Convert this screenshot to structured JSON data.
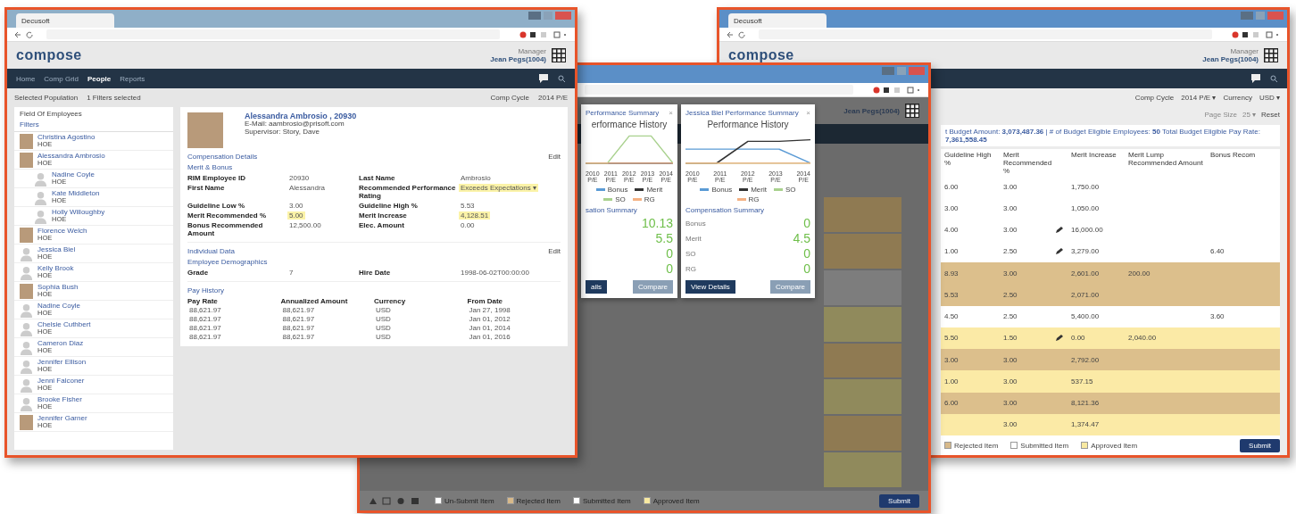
{
  "people_window": {
    "tab": "Decusoft",
    "logo": "compose",
    "user_role": "Manager",
    "user": "Jean Pegs(1004)",
    "nav": [
      {
        "label": "Home",
        "selected": false
      },
      {
        "label": "Comp Grid",
        "selected": false
      },
      {
        "label": "People",
        "selected": true
      },
      {
        "label": "Reports",
        "selected": false
      }
    ],
    "population_label": "Selected Population",
    "population_value": "1 Filters selected",
    "cycle_label": "Comp Cycle",
    "cycle_value": "2014 P/E",
    "list_title": "Field Of Employees",
    "filter_label": "Filters",
    "employees": [
      {
        "name": "Christina Agostino",
        "code": "HOE",
        "kind": "photo"
      },
      {
        "name": "Alessandra Ambrosio",
        "code": "HOE",
        "kind": "photo",
        "children": [
          {
            "name": "Nadine Coyle",
            "code": "HOE",
            "kind": "silhouette"
          },
          {
            "name": "Kate Middleton",
            "code": "HOE",
            "kind": "silhouette"
          },
          {
            "name": "Holly Willoughby",
            "code": "HOE",
            "kind": "silhouette"
          }
        ]
      },
      {
        "name": "Florence Welch",
        "code": "HOE",
        "kind": "photo"
      },
      {
        "name": "Jessica Biel",
        "code": "HOE",
        "kind": "silhouette"
      },
      {
        "name": "Kelly Brook",
        "code": "HOE",
        "kind": "silhouette"
      },
      {
        "name": "Sophia Bush",
        "code": "HOE",
        "kind": "photo"
      },
      {
        "name": "Nadine Coyle",
        "code": "HOE",
        "kind": "silhouette"
      },
      {
        "name": "Chelsie Cuthbert",
        "code": "HOE",
        "kind": "silhouette"
      },
      {
        "name": "Cameron Diaz",
        "code": "HOE",
        "kind": "silhouette"
      },
      {
        "name": "Jennifer Ellison",
        "code": "HOE",
        "kind": "silhouette"
      },
      {
        "name": "Jenni Falconer",
        "code": "HOE",
        "kind": "silhouette"
      },
      {
        "name": "Brooke Fisher",
        "code": "HOE",
        "kind": "silhouette"
      },
      {
        "name": "Jennifer Garner",
        "code": "HOE",
        "kind": "photo"
      }
    ],
    "profile": {
      "name": "Alessandra Ambrosio , 20930",
      "email": "E-Mail: aambrosio@prisoft.com",
      "supervisor": "Supervisor: Story, Dave"
    },
    "comp_title": "Compensation Details",
    "edit": "Edit",
    "merit_title": "Merit & Bonus",
    "merit_fields": [
      {
        "label": "RIM Employee ID",
        "value": "20930",
        "highlighted": false
      },
      {
        "label": "Last Name",
        "value": "Ambrosio",
        "highlighted": false
      },
      {
        "label": "First Name",
        "value": "Alessandra",
        "highlighted": false
      },
      {
        "label": "Recommended Performance Rating",
        "value": "Exceeds Expectations ▾",
        "highlighted": true
      },
      {
        "label": "Guideline Low %",
        "value": "3.00",
        "highlighted": false
      },
      {
        "label": "Guideline High %",
        "value": "5.53",
        "highlighted": false
      },
      {
        "label": "Merit Recommended %",
        "value": "5.00",
        "highlighted": true
      },
      {
        "label": "Merit Increase",
        "value": "4,128.51",
        "highlighted": true
      },
      {
        "label": "Bonus Recommended Amount",
        "value": "12,500.00",
        "highlighted": false
      },
      {
        "label": "Elec. Amount",
        "value": "0.00",
        "highlighted": false
      }
    ],
    "individual_title": "Individual Data",
    "individual_edit": "Edit",
    "demographics_title": "Employee Demographics",
    "demographics": [
      {
        "label": "Grade",
        "value": "7"
      },
      {
        "label": "Hire Date",
        "value": "1998-06-02T00:00:00"
      }
    ],
    "pay_title": "Pay History",
    "pay_columns": [
      "Pay Rate",
      "Annualized Amount",
      "Currency",
      "From Date"
    ],
    "pay_rows": [
      [
        "88,621.97",
        "88,621.97",
        "USD",
        "Jan 27, 1998"
      ],
      [
        "88,621.97",
        "88,621.97",
        "USD",
        "Jan 01, 2012"
      ],
      [
        "88,621.97",
        "88,621.97",
        "USD",
        "Jan 01, 2014"
      ],
      [
        "88,621.97",
        "88,621.97",
        "USD",
        "Jan 01, 2016"
      ]
    ]
  },
  "summary_window": {
    "user": "Jean Pegs(1004)",
    "popups": [
      {
        "title": "Performance Summary",
        "close": "×",
        "chart_title": "erformance History",
        "years": [
          {
            "year": "2010",
            "period": "P/E"
          },
          {
            "year": "2011",
            "period": "P/E"
          },
          {
            "year": "2012",
            "period": "P/E"
          },
          {
            "year": "2013",
            "period": "P/E"
          },
          {
            "year": "2014",
            "period": "P/E"
          }
        ],
        "legend": [
          {
            "label": "Bonus",
            "color": "#5b9bd5"
          },
          {
            "label": "Merit",
            "color": "#333333"
          },
          {
            "label": "SO",
            "color": "#a9d18e"
          },
          {
            "label": "RG",
            "color": "#f4b183"
          }
        ],
        "summary_title": "sation Summary",
        "summary": [
          {
            "value": "10.13"
          },
          {
            "value": "5.5"
          },
          {
            "value": "0"
          },
          {
            "value": "0"
          }
        ],
        "buttons": [
          "ails",
          "Compare"
        ]
      },
      {
        "title": "Jessica Biel Performance Summary",
        "close": "×",
        "chart_title": "Performance History",
        "years": [
          {
            "year": "2010",
            "period": "P/E"
          },
          {
            "year": "2011",
            "period": "P/E"
          },
          {
            "year": "2012",
            "period": "P/E"
          },
          {
            "year": "2013",
            "period": "P/E"
          },
          {
            "year": "2014",
            "period": "P/E"
          }
        ],
        "legend": [
          {
            "label": "Bonus",
            "color": "#5b9bd5"
          },
          {
            "label": "Merit",
            "color": "#333333"
          },
          {
            "label": "SO",
            "color": "#a9d18e"
          },
          {
            "label": "RG",
            "color": "#f4b183"
          }
        ],
        "summary_title": "Compensation Summary",
        "summary": [
          {
            "label": "Bonus",
            "value": "0"
          },
          {
            "label": "Merit",
            "value": "4.5"
          },
          {
            "label": "SO",
            "value": "0"
          },
          {
            "label": "RG",
            "value": "0"
          }
        ],
        "buttons": [
          "View Details",
          "Compare"
        ]
      }
    ],
    "legend": [
      {
        "label": "Un-Submit Item",
        "kind": "plain"
      },
      {
        "label": "Rejected Item",
        "kind": "rejected"
      },
      {
        "label": "Submitted Item",
        "kind": "submitted"
      },
      {
        "label": "Approved Item",
        "kind": "approved"
      }
    ],
    "submit": "Submit"
  },
  "grid_window": {
    "tab": "Decusoft",
    "logo": "compose",
    "user_role": "Manager",
    "user": "Jean Pegs(1004)",
    "cycle_label": "Comp Cycle",
    "cycle_value": "2014 P/E ▾",
    "currency_label": "Currency",
    "currency_value": "USD ▾",
    "page_size_label": "Page Size",
    "page_size_value": "25 ▾",
    "reset": "Reset",
    "banner": "t Budget Amount: **3,073,487.36** | # of Budget Eligible Employees: **50** Total Budget Eligible Pay Rate: **7,361,558.45**",
    "columns": [
      "Guideline High %",
      "Merit Recommended %",
      "Merit Increase",
      "Merit Lump Recommended Amount",
      "Bonus Recom"
    ],
    "rows": [
      {
        "kind": "plain",
        "edited": false,
        "guideline_high": "6.00",
        "merit_recommended": "3.00",
        "merit_increase": "1,750.00"
      },
      {
        "kind": "plain",
        "edited": false,
        "guideline_high": "3.00",
        "merit_recommended": "3.00",
        "merit_increase": "1,050.00"
      },
      {
        "kind": "plain",
        "edited": true,
        "guideline_high": "4.00",
        "merit_recommended": "3.00",
        "merit_increase": "16,000.00"
      },
      {
        "kind": "plain",
        "edited": true,
        "guideline_high": "1.00",
        "merit_recommended": "2.50",
        "merit_increase": "3,279.00",
        "bonus": "6.40"
      },
      {
        "kind": "rejected",
        "edited": false,
        "guideline_high": "8.93",
        "merit_recommended": "3.00",
        "merit_increase": "2,601.00",
        "merit_lump": "200.00"
      },
      {
        "kind": "rejected",
        "edited": false,
        "guideline_high": "5.53",
        "merit_recommended": "2.50",
        "merit_increase": "2,071.00"
      },
      {
        "kind": "plain",
        "edited": false,
        "guideline_high": "4.50",
        "merit_recommended": "2.50",
        "merit_increase": "5,400.00",
        "bonus": "3.60"
      },
      {
        "kind": "approved",
        "edited": true,
        "guideline_high": "5.50",
        "merit_recommended": "1.50",
        "merit_increase": "0.00",
        "merit_lump": "2,040.00"
      },
      {
        "kind": "rejected",
        "edited": false,
        "guideline_high": "3.00",
        "merit_recommended": "3.00",
        "merit_increase": "2,792.00"
      },
      {
        "kind": "approved",
        "edited": false,
        "guideline_high": "1.00",
        "merit_recommended": "3.00",
        "merit_increase": "537.15"
      },
      {
        "kind": "rejected",
        "edited": false,
        "guideline_high": "6.00",
        "merit_recommended": "3.00",
        "merit_increase": "8,121.36"
      },
      {
        "kind": "approved",
        "edited": false,
        "merit_recommended": "3.00",
        "merit_increase": "1,374.47"
      }
    ],
    "legend": [
      {
        "label": "Rejected Item",
        "kind": "rejected"
      },
      {
        "label": "Submitted Item",
        "kind": "submitted"
      },
      {
        "label": "Approved Item",
        "kind": "approved"
      }
    ],
    "submit": "Submit"
  }
}
